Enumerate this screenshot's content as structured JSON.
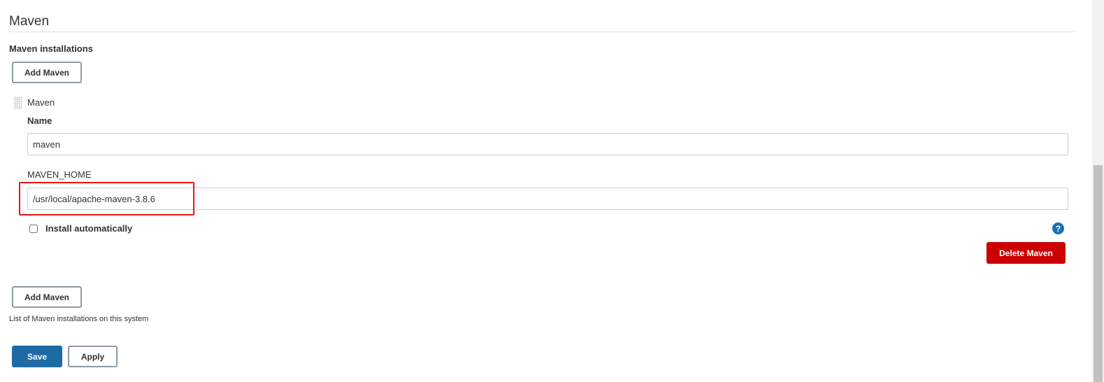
{
  "section": {
    "title": "Maven",
    "subheading": "Maven installations"
  },
  "add_button_label": "Add Maven",
  "installation": {
    "header": "Maven",
    "name_label": "Name",
    "name_value": "maven",
    "home_label": "MAVEN_HOME",
    "home_value": "/usr/local/apache-maven-3.8.6",
    "install_auto_label": "Install automatically",
    "install_auto_checked": false,
    "delete_label": "Delete Maven",
    "help_glyph": "?"
  },
  "help_text": "List of Maven installations on this system",
  "footer": {
    "save_label": "Save",
    "apply_label": "Apply"
  },
  "colors": {
    "delete": "#cc0000",
    "save": "#1d6aa5",
    "highlight": "#e8141b",
    "help_icon": "#1a6fb4"
  },
  "icons": {
    "drag": "drag-handle-icon",
    "help": "help-icon"
  }
}
